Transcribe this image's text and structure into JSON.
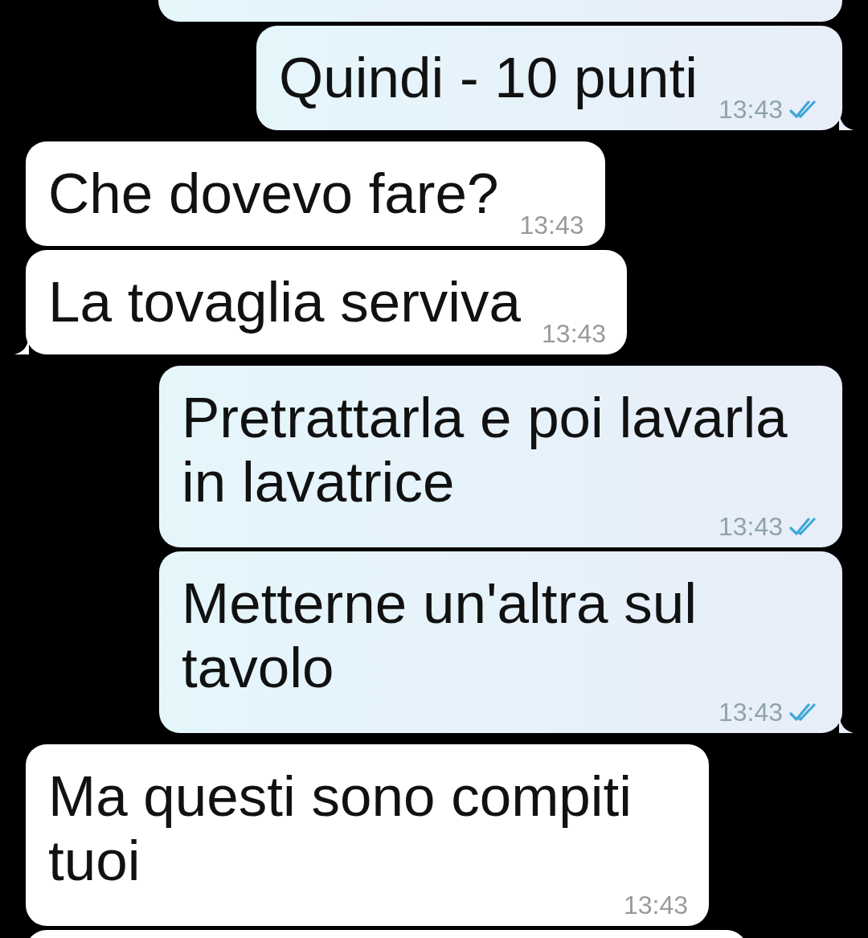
{
  "messages": [
    {
      "kind": "cut",
      "outgoing": true
    },
    {
      "kind": "message",
      "outgoing": true,
      "text": "Quindi - 10 punti",
      "time": "13:43",
      "read": true,
      "tail": true
    },
    {
      "kind": "message",
      "outgoing": false,
      "text": "Che dovevo fare?",
      "time": "13:43",
      "tail": false
    },
    {
      "kind": "message",
      "outgoing": false,
      "text": "La tovaglia serviva",
      "time": "13:43",
      "tail": true
    },
    {
      "kind": "message",
      "outgoing": true,
      "text": "Pretrattarla e poi lavarla in lavatrice",
      "time": "13:43",
      "read": true,
      "tail": false
    },
    {
      "kind": "message",
      "outgoing": true,
      "text": "Metterne un'altra sul tavolo",
      "time": "13:43",
      "read": true,
      "tail": true
    },
    {
      "kind": "message",
      "outgoing": false,
      "text": "Ma questi sono compiti tuoi",
      "time": "13:43",
      "tail": false
    },
    {
      "kind": "cut",
      "outgoing": false
    }
  ]
}
